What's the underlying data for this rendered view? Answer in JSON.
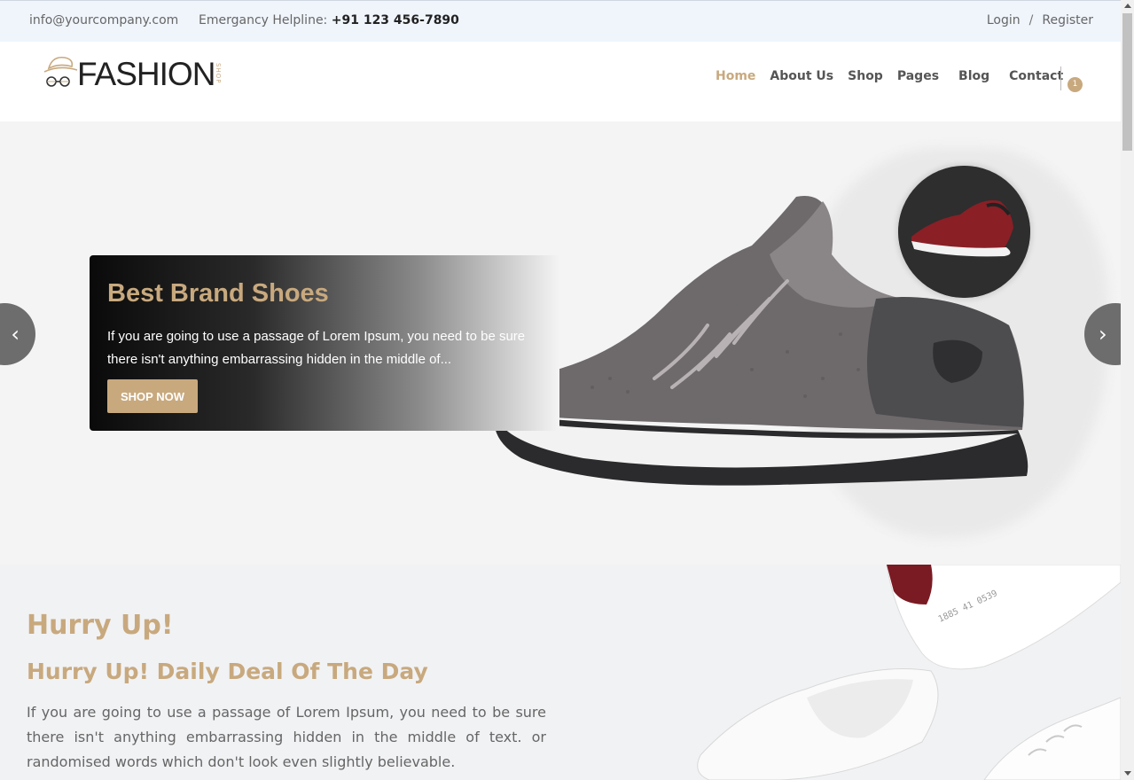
{
  "topbar": {
    "email": "info@yourcompany.com",
    "helpline_label": "Emergancy Helpline:",
    "helpline_number": "+91 123 456-7890",
    "login": "Login",
    "separator": "/",
    "register": "Register"
  },
  "header": {
    "logo_text": "FASHION",
    "logo_sub": "SHOP",
    "nav": [
      "Home",
      "About Us",
      "Shop",
      "Pages",
      "Blog",
      "Contact"
    ],
    "cart_count": "1"
  },
  "hero": {
    "title": "Best Brand Shoes",
    "text": "If you are going to use a passage of Lorem Ipsum, you need to be sure there isn't anything embarrassing hidden in the middle of...",
    "button": "SHOP NOW",
    "prev_icon": "‹",
    "next_icon": "›"
  },
  "deal": {
    "title": "Hurry Up!",
    "subtitle": "Hurry Up! Daily Deal Of The Day",
    "text": "If you are going to use a passage of Lorem Ipsum, you need to be sure there isn't anything embarrassing hidden in the middle of text. or randomised words which don't look even slightly believable.",
    "shoe_print": "1885 41 0539"
  },
  "colors": {
    "accent": "#c8a97e",
    "topbar_bg": "#f0f5fc",
    "hero_bg": "#f4f4f4"
  }
}
